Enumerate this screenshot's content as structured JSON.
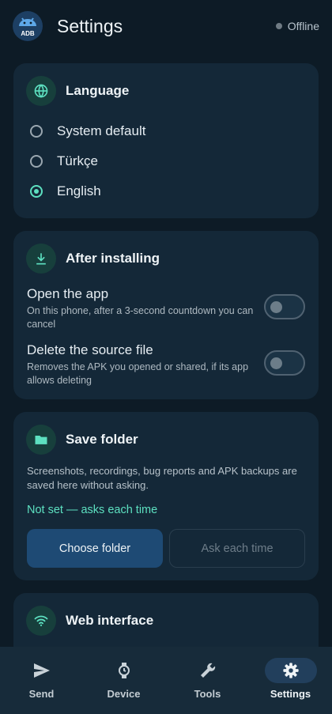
{
  "header": {
    "title": "Settings",
    "logo_text": "ADB",
    "status_text": "Offline"
  },
  "language_card": {
    "title": "Language",
    "icon": "globe-icon",
    "options": [
      {
        "label": "System default",
        "selected": false
      },
      {
        "label": "Türkçe",
        "selected": false
      },
      {
        "label": "English",
        "selected": true
      }
    ]
  },
  "after_install_card": {
    "title": "After installing",
    "icon": "download-icon",
    "options": [
      {
        "title": "Open the app",
        "description": "On this phone, after a 3-second countdown you can cancel",
        "enabled": false
      },
      {
        "title": "Delete the source file",
        "description": "Removes the APK you opened or shared, if its app allows deleting",
        "enabled": false
      }
    ]
  },
  "save_folder_card": {
    "title": "Save folder",
    "icon": "folder-icon",
    "description": "Screenshots, recordings, bug reports and APK backups are saved here without asking.",
    "status": "Not set — asks each time",
    "choose_button": "Choose folder",
    "ask_button": "Ask each time"
  },
  "web_card": {
    "title": "Web interface",
    "icon": "wifi-icon"
  },
  "bottom_nav": [
    {
      "label": "Send",
      "icon": "send-icon",
      "active": false
    },
    {
      "label": "Device",
      "icon": "watch-icon",
      "active": false
    },
    {
      "label": "Tools",
      "icon": "wrench-icon",
      "active": false
    },
    {
      "label": "Settings",
      "icon": "gear-icon",
      "active": true
    }
  ],
  "colors": {
    "background": "#0d1b26",
    "card": "#142838",
    "accent": "#5de0c0",
    "primary_button": "#1e4a74"
  }
}
